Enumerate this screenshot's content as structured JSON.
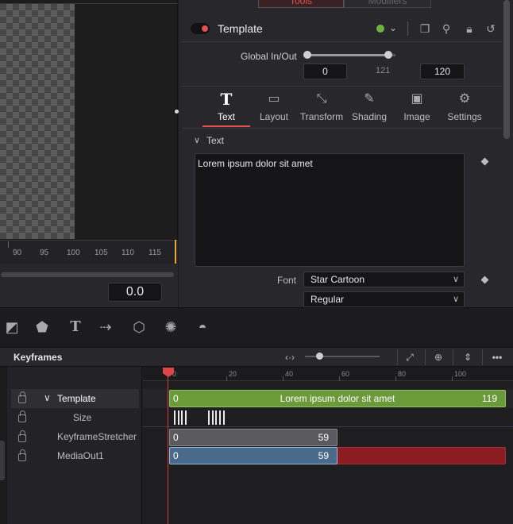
{
  "inspector": {
    "tabs": [
      {
        "label": "Tools"
      },
      {
        "label": "Modifiers"
      }
    ],
    "node_name": "Template",
    "global_in_out": {
      "label": "Global In/Out",
      "in_value": "0",
      "mid_value": "121",
      "out_value": "120"
    },
    "control_tabs": [
      {
        "label": "Text",
        "icon": "text-icon",
        "glyph": "T"
      },
      {
        "label": "Layout",
        "icon": "layout-icon",
        "glyph": "▭"
      },
      {
        "label": "Transform",
        "icon": "transform-icon",
        "glyph": "⤡"
      },
      {
        "label": "Shading",
        "icon": "shading-icon",
        "glyph": "✎"
      },
      {
        "label": "Image",
        "icon": "image-icon",
        "glyph": "▣"
      },
      {
        "label": "Settings",
        "icon": "settings-icon",
        "glyph": "⚙"
      }
    ],
    "section_label": "Text",
    "styled_text": "Lorem ipsum dolor sit amet",
    "font_label": "Font",
    "font_value": "Star Cartoon",
    "style_value": "Regular"
  },
  "viewer": {
    "ruler_labels": [
      "90",
      "95",
      "100",
      "105",
      "110",
      "115"
    ],
    "frame_value": "0.0"
  },
  "keyframes": {
    "title": "Keyframes",
    "ruler_labels": [
      "0",
      "20",
      "40",
      "60",
      "80",
      "100"
    ],
    "tracks": [
      {
        "label": "Template",
        "start": "0",
        "end": "119",
        "text": "Lorem ipsum dolor sit amet"
      },
      {
        "label": "Size"
      },
      {
        "label": "KeyframeStretcher",
        "start": "0",
        "end": "59"
      },
      {
        "label": "MediaOut1",
        "start": "0",
        "end": "59"
      }
    ]
  },
  "colors": {
    "accent_red": "#e05050",
    "template_bar": "#6b9a3a",
    "stretcher_bar": "#5a5a5e",
    "mediaout_bar": "#4a6a8c",
    "mediaout_tail": "#8a1c22"
  }
}
